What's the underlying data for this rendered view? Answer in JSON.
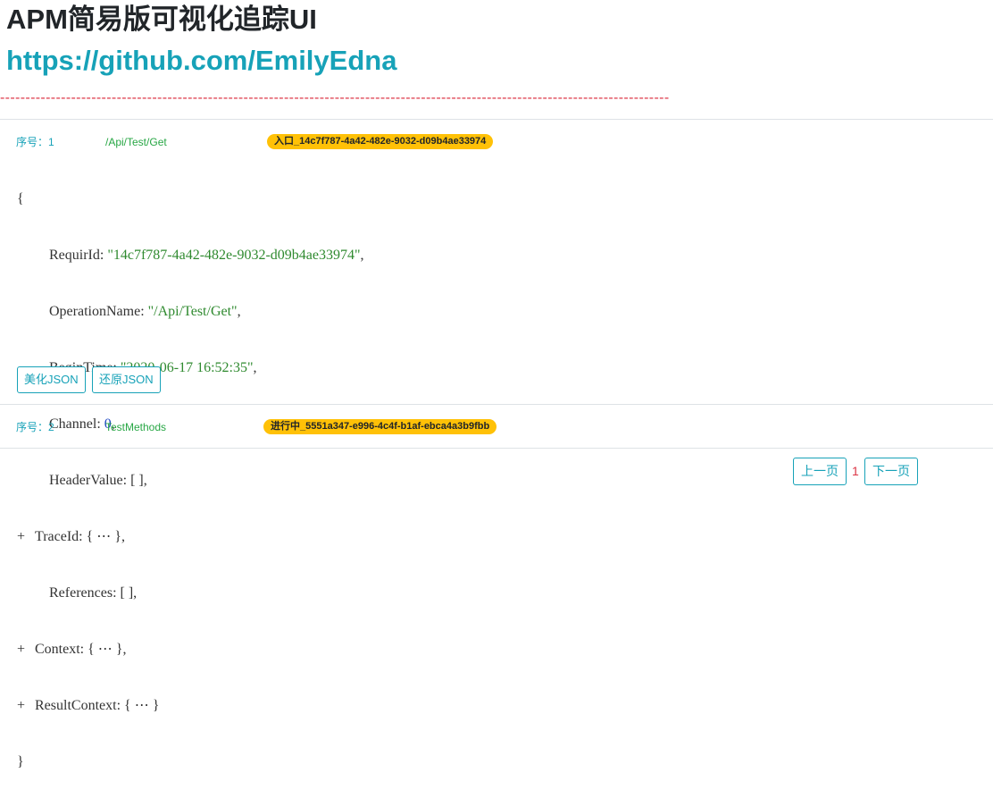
{
  "header": {
    "title": "APM简易版可视化追踪UI",
    "link": "https://github.com/EmilyEdna",
    "divider": "------------------------------------------------------------------------------------------------------------------------------------"
  },
  "traces": [
    {
      "seq_label": "序号：1",
      "operation": "/Api/Test/Get",
      "badge": "入口_14c7f787-4a42-482e-9032-d09b4ae33974",
      "json": {
        "open": "{",
        "close": "}",
        "requir_key": "RequirId",
        "requir_val": "\"14c7f787-4a42-482e-9032-d09b4ae33974\"",
        "opname_key": "OperationName",
        "opname_val": "\"/Api/Test/Get\"",
        "begin_key": "BeginTime",
        "begin_val": "\"2020-06-17 16:52:35\"",
        "channel_key": "Channel",
        "channel_val": "0",
        "header_key": "HeaderValue",
        "header_val": "[ ]",
        "trace_key": "TraceId",
        "trace_val": "{ ⋯ }",
        "refs_key": "References",
        "refs_val": "[ ]",
        "context_key": "Context",
        "context_val": "{ ⋯ }",
        "result_key": "ResultContext",
        "result_val": "{ ⋯ }",
        "expand_symbol": "+"
      },
      "beautify_label": "美化JSON",
      "restore_label": "还原JSON"
    },
    {
      "seq_label": "序号：2",
      "operation": "TestMethods",
      "badge": "进行中_5551a347-e996-4c4f-b1af-ebca4a3b9fbb"
    }
  ],
  "pagination": {
    "prev_label": "上一页",
    "current": "1",
    "next_label": "下一页"
  },
  "colors": {
    "accent": "#17a2b8",
    "operation": "#28a745",
    "badge": "#ffc107",
    "divider": "#dc3545",
    "json_string": "#2f8a2f",
    "json_number": "#1a44c4"
  }
}
